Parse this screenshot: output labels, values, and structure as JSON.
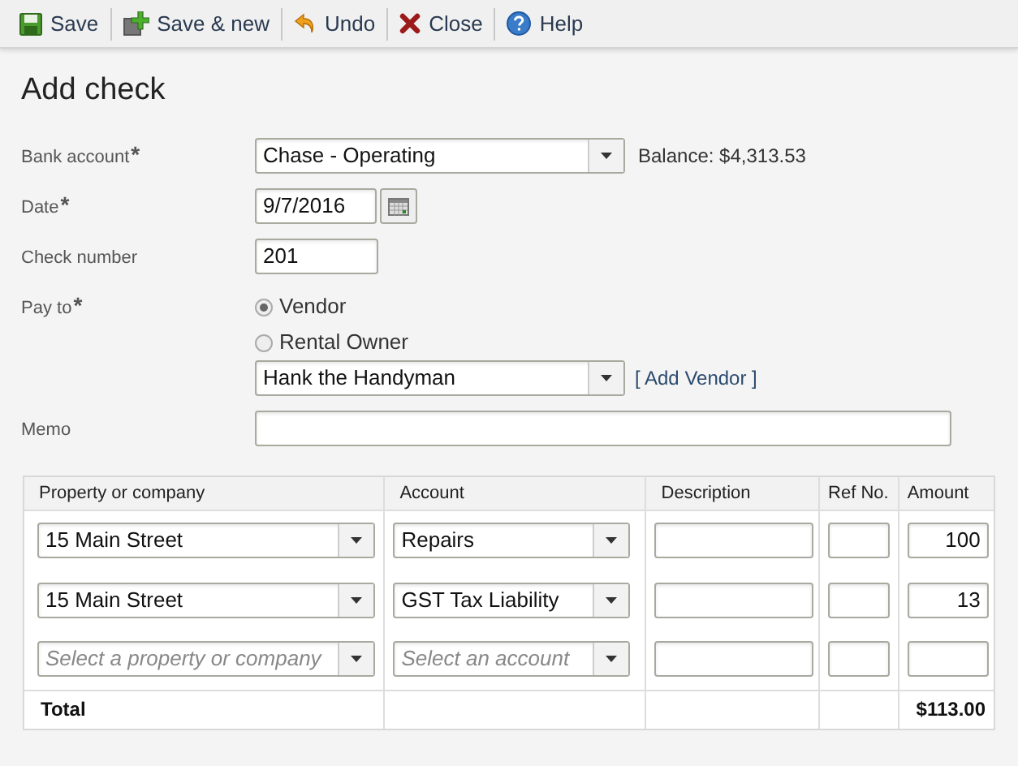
{
  "toolbar": [
    {
      "kind": "save",
      "label": "Save"
    },
    {
      "kind": "save_new",
      "label": "Save & new"
    },
    {
      "kind": "undo",
      "label": "Undo"
    },
    {
      "kind": "close",
      "label": "Close"
    },
    {
      "kind": "help",
      "label": "Help"
    }
  ],
  "title": "Add check",
  "form": {
    "bank_account": {
      "label": "Bank account",
      "required_mark": "*",
      "value": "Chase - Operating",
      "balance": "Balance: $4,313.53"
    },
    "date": {
      "label": "Date",
      "required_mark": "*",
      "value": "9/7/2016"
    },
    "check_number": {
      "label": "Check number",
      "value": "201"
    },
    "pay_to": {
      "label": "Pay to",
      "required_mark": "*",
      "options": [
        {
          "label": "Vendor",
          "selected": true
        },
        {
          "label": "Rental Owner",
          "selected": false
        }
      ],
      "value": "Hank the Handyman",
      "add_link": "[ Add Vendor ]"
    },
    "memo": {
      "label": "Memo"
    }
  },
  "table": {
    "columns": [
      "Property or company",
      "Account",
      "Description",
      "Ref No.",
      "Amount"
    ],
    "rows": [
      {
        "property": {
          "value": "15 Main Street"
        },
        "account": {
          "value": "Repairs"
        },
        "amount": "100"
      },
      {
        "property": {
          "value": "15 Main Street"
        },
        "account": {
          "value": "GST Tax Liability"
        },
        "amount": "13"
      },
      {
        "property": {
          "placeholder": "Select a property or company"
        },
        "account": {
          "placeholder": "Select an account"
        }
      }
    ],
    "total": {
      "label": "Total",
      "amount": "$113.00"
    }
  }
}
